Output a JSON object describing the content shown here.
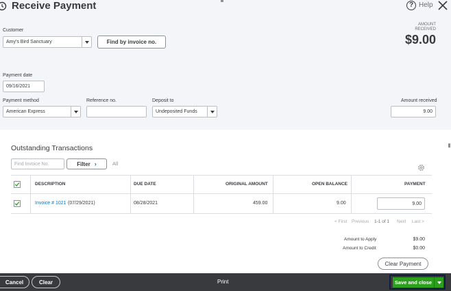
{
  "header": {
    "title": "Receive Payment",
    "help_label": "Help"
  },
  "customer": {
    "label": "Customer",
    "value": "Amy's Bird Sanctuary",
    "find_button": "Find by invoice no."
  },
  "amount_received_summary": {
    "caption_line1": "AMOUNT",
    "caption_line2": "RECEIVED",
    "value": "$9.00"
  },
  "payment_date": {
    "label": "Payment date",
    "value": "09/16/2021"
  },
  "payment_method": {
    "label": "Payment method",
    "value": "American Express"
  },
  "reference": {
    "label": "Reference no.",
    "value": ""
  },
  "deposit_to": {
    "label": "Deposit to",
    "value": "Undeposited Funds"
  },
  "amount_received": {
    "label": "Amount received",
    "value": "9.00"
  },
  "outstanding": {
    "title": "Outstanding Transactions",
    "find_placeholder": "Find Invoice No.",
    "filter_label": "Filter",
    "all_label": "All",
    "columns": {
      "description": "DESCRIPTION",
      "due_date": "DUE DATE",
      "original_amount": "ORIGINAL AMOUNT",
      "open_balance": "OPEN BALANCE",
      "payment": "PAYMENT"
    },
    "rows": [
      {
        "invoice_link": "Invoice # 1021",
        "invoice_date": "(07/29/2021)",
        "due_date": "08/28/2021",
        "original_amount": "459.00",
        "open_balance": "9.00",
        "payment": "9.00"
      }
    ],
    "pager": {
      "first": "< First",
      "previous": "Previous",
      "range": "1-1 of 1",
      "next": "Next",
      "last": "Last >"
    }
  },
  "totals": {
    "apply_label": "Amount to Apply",
    "apply_value": "$9.00",
    "credit_label": "Amount to Credit",
    "credit_value": "$0.00",
    "clear_payment": "Clear Payment"
  },
  "footer": {
    "cancel": "Cancel",
    "clear": "Clear",
    "print": "Print",
    "save_close": "Save and close"
  },
  "colors": {
    "accent_green": "#2ca01c",
    "link_blue": "#0077c5",
    "footer_bg": "#393a3d"
  }
}
